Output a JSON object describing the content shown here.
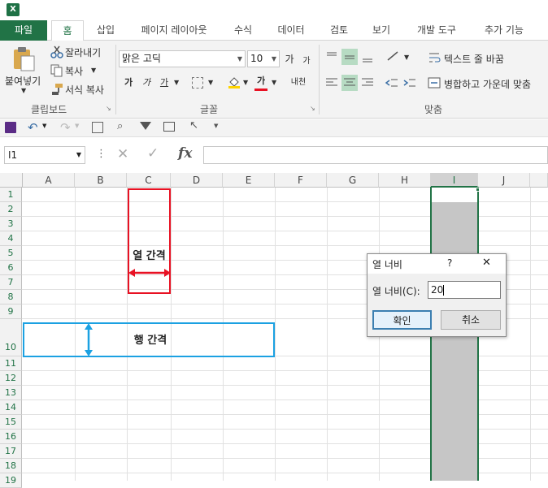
{
  "app": {
    "icon_letter": "X"
  },
  "tabs": [
    "파일",
    "홈",
    "삽입",
    "페이지 레이아웃",
    "수식",
    "데이터",
    "검토",
    "보기",
    "개발 도구",
    "추가 기능"
  ],
  "ribbon": {
    "clipboard": {
      "paste": "붙여넣기",
      "cut": "잘라내기",
      "copy": "복사",
      "format_painter": "서식 복사",
      "group_label": "클립보드"
    },
    "font": {
      "font_name": "맑은 고딕",
      "font_size": "10",
      "grow": "가",
      "shrink": "가",
      "bold": "가",
      "italic": "가",
      "underline": "가",
      "font_color_letter": "가",
      "phonetic": "내천",
      "group_label": "글꼴"
    },
    "alignment": {
      "wrap_text": "텍스트 줄 바꿈",
      "merge_center": "병합하고 가운데 맞춤",
      "group_label": "맞춤"
    }
  },
  "formula_bar": {
    "name_box": "I1",
    "fx": "fx",
    "value": ""
  },
  "columns": [
    "A",
    "B",
    "C",
    "D",
    "E",
    "F",
    "G",
    "H",
    "I",
    "J"
  ],
  "rows": [
    "1",
    "2",
    "3",
    "4",
    "5",
    "6",
    "7",
    "8",
    "9",
    "10",
    "11",
    "12",
    "13",
    "14",
    "15",
    "16",
    "17",
    "18",
    "19"
  ],
  "annotations": {
    "column_spacing": "열 간격",
    "row_spacing": "행 간격"
  },
  "dialog": {
    "title": "열 너비",
    "help": "?",
    "close": "✕",
    "field_label": "열 너비(C):",
    "field_value": "20",
    "ok": "확인",
    "cancel": "취소"
  },
  "colors": {
    "excel_green": "#217346",
    "red_box": "#e81123",
    "blue_box": "#1ba1e2",
    "selection": "#c6c6c6"
  }
}
